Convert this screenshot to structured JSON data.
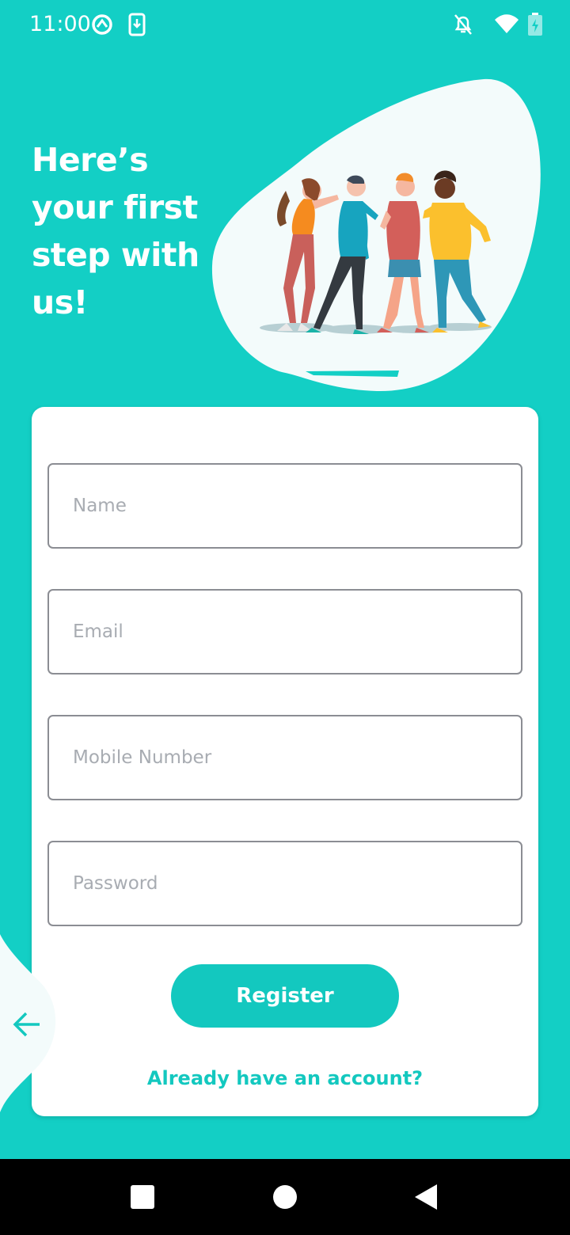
{
  "status_bar": {
    "time": "11:00",
    "icons": [
      "data-saver-icon",
      "download-icon",
      "notifications-off-icon",
      "wifi-icon",
      "battery-charging-icon"
    ]
  },
  "header": {
    "title": "Here’s your first step with us!",
    "illustration": "people-group-illustration"
  },
  "form": {
    "fields": [
      {
        "name": "name",
        "placeholder": "Name",
        "value": ""
      },
      {
        "name": "email",
        "placeholder": "Email",
        "value": ""
      },
      {
        "name": "mobile",
        "placeholder": "Mobile Number",
        "value": ""
      },
      {
        "name": "password",
        "placeholder": "Password",
        "value": ""
      }
    ],
    "register_label": "Register",
    "login_link": "Already have an account?"
  },
  "back_button": {
    "icon": "arrow-left-icon"
  },
  "nav_bar": {
    "icons": [
      "recents-square-icon",
      "home-circle-icon",
      "back-triangle-icon"
    ]
  },
  "colors": {
    "background": "#13cfc5",
    "accent": "#13c8bf",
    "card": "#ffffff",
    "field_border": "#8b8d93",
    "placeholder": "#a8acb2"
  }
}
